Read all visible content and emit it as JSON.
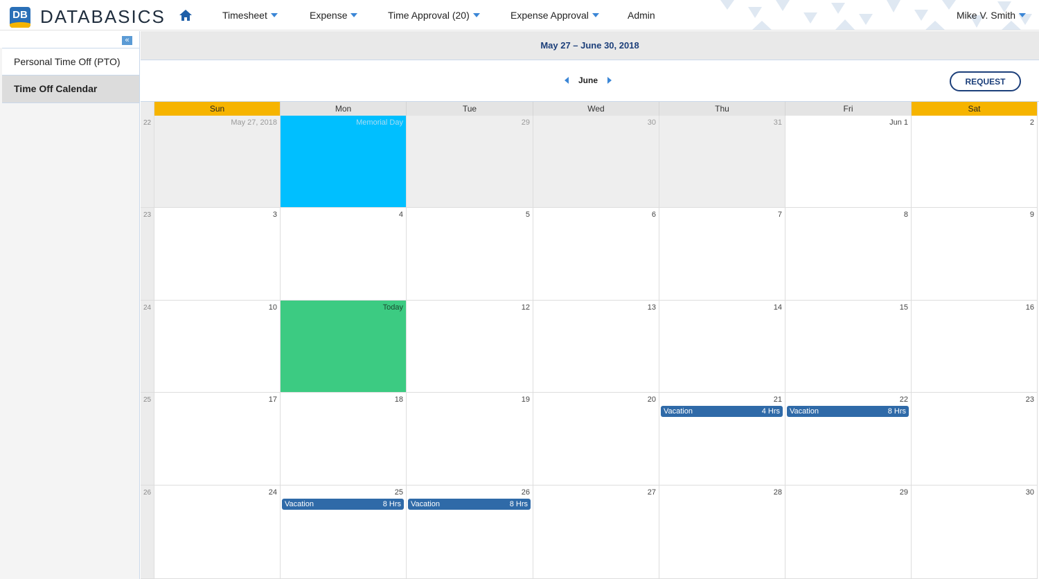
{
  "header": {
    "logo_badge": "DB",
    "logo_text": "DATABASICS",
    "nav": {
      "timesheet": "Timesheet",
      "expense": "Expense",
      "time_approval": "Time Approval (20)",
      "expense_approval": "Expense Approval",
      "admin": "Admin"
    },
    "user": "Mike V. Smith"
  },
  "sidebar": {
    "collapse_glyph": "«",
    "items": [
      {
        "label": "Personal Time Off (PTO)"
      },
      {
        "label": "Time Off Calendar"
      }
    ]
  },
  "main": {
    "date_range": "May 27 – June 30, 2018",
    "month": "June",
    "request_label": "REQUEST"
  },
  "calendar": {
    "days_of_week": [
      "Sun",
      "Mon",
      "Tue",
      "Wed",
      "Thu",
      "Fri",
      "Sat"
    ],
    "weeks": [
      {
        "num": "22",
        "days": [
          {
            "label": "May 27, 2018",
            "state": "other"
          },
          {
            "label": "Memorial Day",
            "state": "holiday"
          },
          {
            "label": "29",
            "state": "other"
          },
          {
            "label": "30",
            "state": "other"
          },
          {
            "label": "31",
            "state": "other"
          },
          {
            "label": "Jun 1",
            "state": "normal"
          },
          {
            "label": "2",
            "state": "normal"
          }
        ]
      },
      {
        "num": "23",
        "days": [
          {
            "label": "3"
          },
          {
            "label": "4"
          },
          {
            "label": "5"
          },
          {
            "label": "6"
          },
          {
            "label": "7"
          },
          {
            "label": "8"
          },
          {
            "label": "9"
          }
        ]
      },
      {
        "num": "24",
        "days": [
          {
            "label": "10"
          },
          {
            "label": "Today",
            "state": "today"
          },
          {
            "label": "12"
          },
          {
            "label": "13"
          },
          {
            "label": "14"
          },
          {
            "label": "15"
          },
          {
            "label": "16"
          }
        ]
      },
      {
        "num": "25",
        "days": [
          {
            "label": "17"
          },
          {
            "label": "18"
          },
          {
            "label": "19"
          },
          {
            "label": "20"
          },
          {
            "label": "21",
            "event": {
              "name": "Vacation",
              "hours": "4 Hrs"
            }
          },
          {
            "label": "22",
            "event": {
              "name": "Vacation",
              "hours": "8 Hrs"
            }
          },
          {
            "label": "23"
          }
        ]
      },
      {
        "num": "26",
        "days": [
          {
            "label": "24"
          },
          {
            "label": "25",
            "event": {
              "name": "Vacation",
              "hours": "8 Hrs"
            }
          },
          {
            "label": "26",
            "event": {
              "name": "Vacation",
              "hours": "8 Hrs"
            }
          },
          {
            "label": "27"
          },
          {
            "label": "28"
          },
          {
            "label": "29"
          },
          {
            "label": "30"
          }
        ]
      }
    ]
  },
  "colors": {
    "weekend_header": "#f6b400",
    "holiday": "#00bfff",
    "today": "#3ccb82",
    "event": "#2f6aa8",
    "accent": "#3b86d6"
  }
}
